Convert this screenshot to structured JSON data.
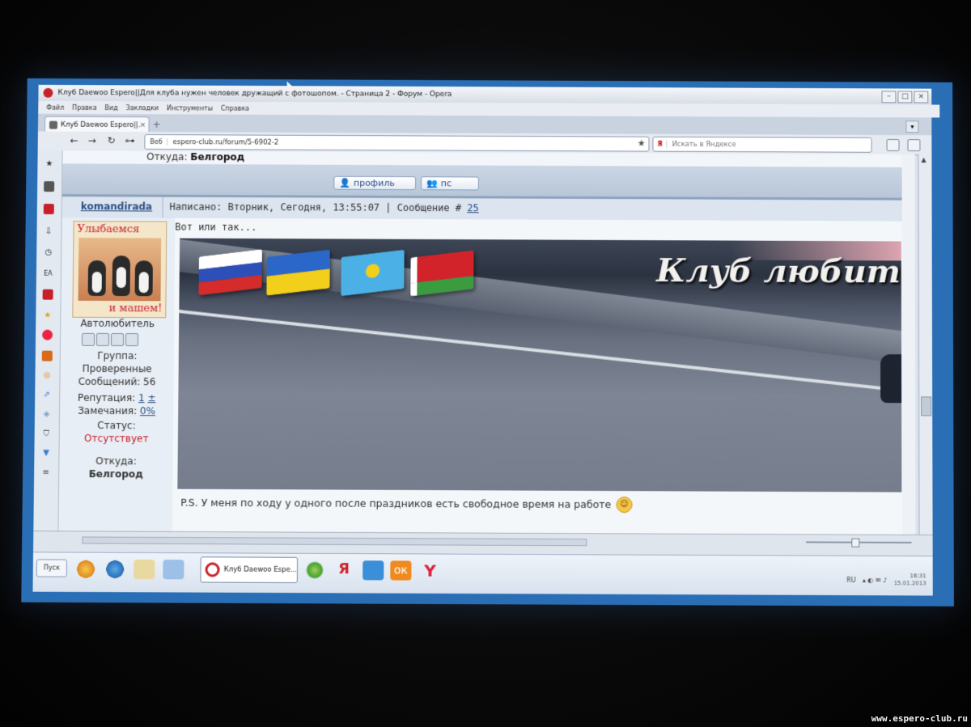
{
  "browser": {
    "title": "Клуб Daewoo Espero||Для клуба нужен человек дружащий с фотошопом. - Страница 2 - Форум - Opera",
    "menu": [
      "Файл",
      "Правка",
      "Вид",
      "Закладки",
      "Инструменты",
      "Справка"
    ],
    "tab_label": "Клуб Daewoo Espero||...",
    "tab_close": "×",
    "new_tab": "+",
    "url_prefix": "Веб",
    "url": "espero-club.ru/forum/5-6902-2",
    "search_engine": "Я",
    "search_placeholder": "Искать в Яндексе"
  },
  "forum": {
    "prev_from_label": "Откуда:",
    "prev_from_value": "Белгород",
    "profile_button": "профиль",
    "pm_button": "пс",
    "post": {
      "author": "komandirada",
      "meta": "Написано: Вторник, Сегодня, 13:55:07 | Сообщение #",
      "number": "25",
      "text": "Вот или так...",
      "banner_title": "Клуб любителе",
      "ps": "P.S. У меня по ходу у одного после праздников есть свободное время на работе"
    },
    "user": {
      "avatar_top": "Улыбаемся",
      "avatar_bottom": "и машем!",
      "rank": "Автолюбитель",
      "group_label": "Группа:",
      "group_value": "Проверенные",
      "messages": "Сообщений: 56",
      "reputation_label": "Репутация:",
      "reputation_value": "1",
      "reputation_plus": "±",
      "warnings_label": "Замечания:",
      "warnings_value": "0%",
      "status_label": "Статус:",
      "status_value": "Отсутствует",
      "from_label": "Откуда:",
      "from_value": "Белгород"
    }
  },
  "taskbar": {
    "start": "Пуск",
    "active_item": "Клуб Daewoo Espe...",
    "lang": "RU",
    "time": "16:31",
    "date": "15.01.2013"
  },
  "watermark": "www.espero-club.ru",
  "colors": {
    "accent": "#2c4e84",
    "status_red": "#c8202a",
    "desktop_blue": "#2a6fb6"
  },
  "icons": [
    "opera-icon",
    "back-icon",
    "forward-icon",
    "reload-icon",
    "key-icon",
    "bookmark-star-icon",
    "yandex-icon",
    "profile-icon",
    "pm-icon",
    "smiley-icon"
  ]
}
